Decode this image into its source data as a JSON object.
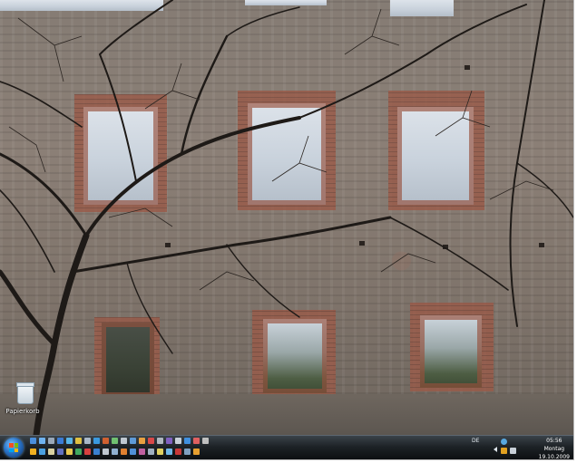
{
  "desktop": {
    "icons": [
      {
        "label": "Papierkorb",
        "icon": "recycle-bin-icon"
      }
    ]
  },
  "taskbar": {
    "start_icon": "windows-orb-icon",
    "quick_launch_row1": [
      "#4b8fdc",
      "#6fb3f0",
      "#9aa8b8",
      "#3a7bd5",
      "#58b5e8",
      "#e0c040",
      "#a8b8c8",
      "#3a9ae0",
      "#d06030",
      "#70c070",
      "#c0c8d0",
      "#5e9ad8",
      "#e8a040",
      "#d84848",
      "#b0b8c0",
      "#8060c0",
      "#c8d0d8",
      "#4090e0",
      "#e06060",
      "#c0c0c0"
    ],
    "quick_launch_row2": [
      "#f0b020",
      "#4aa0e0",
      "#d8d0a0",
      "#6070c0",
      "#e8c850",
      "#40a860",
      "#d84040",
      "#3a80d0",
      "#c0c8d0",
      "#90b0d0",
      "#e08030",
      "#5090d8",
      "#c060a0",
      "#a0b0c0",
      "#e0d060",
      "#70b8e8",
      "#c83838",
      "#80a0c0",
      "#e8a030"
    ],
    "language": "DE",
    "tray_icons": [
      "network-icon",
      "volume-icon",
      "antivirus-icon",
      "chevron-left-icon"
    ],
    "clock": {
      "time": "05:56",
      "day": "Montag",
      "date": "19.10.2009"
    }
  }
}
